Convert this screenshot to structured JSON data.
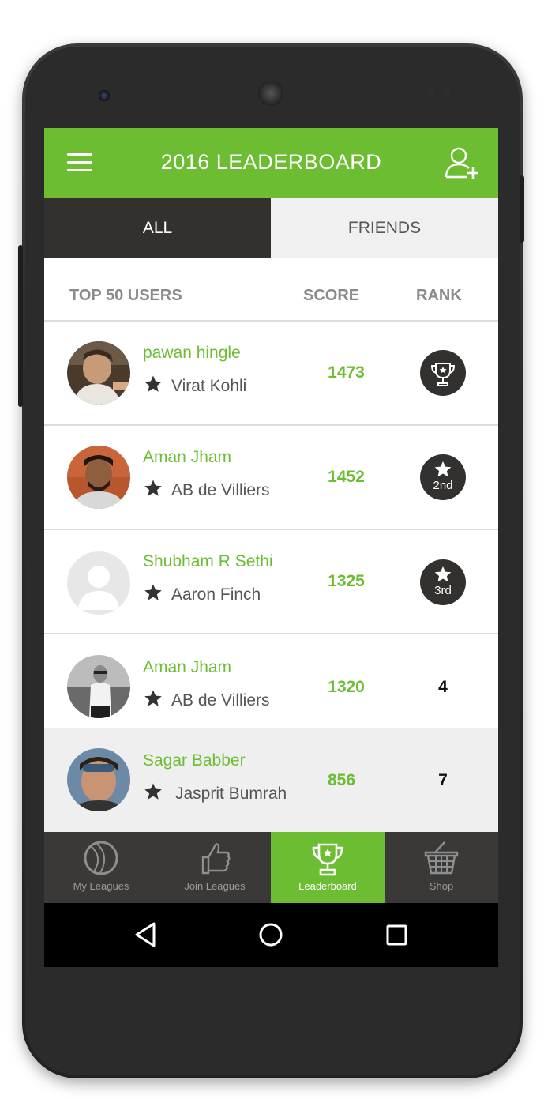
{
  "header": {
    "title": "2016 LEADERBOARD",
    "menu_icon": "hamburger-icon",
    "add_user_icon": "add-user-icon"
  },
  "tabs": [
    {
      "label": "ALL",
      "active": true
    },
    {
      "label": "FRIENDS",
      "active": false
    }
  ],
  "columns": {
    "users": "TOP 50 USERS",
    "score": "SCORE",
    "rank": "RANK"
  },
  "rows": [
    {
      "name": "pawan hingle",
      "player": "Virat Kohli",
      "score": "1473",
      "rank": "",
      "badge": "trophy"
    },
    {
      "name": "Aman Jham",
      "player": "AB de Villiers",
      "score": "1452",
      "rank": "2nd",
      "badge": "star"
    },
    {
      "name": "Shubham R Sethi",
      "player": "Aaron Finch",
      "score": "1325",
      "rank": "3rd",
      "badge": "star"
    },
    {
      "name": "Aman Jham",
      "player": "AB de Villiers",
      "score": "1320",
      "rank": "4",
      "badge": "none"
    },
    {
      "name": "Sagar Babber",
      "player": "Jasprit Bumrah",
      "score": "856",
      "rank": "7",
      "badge": "none"
    }
  ],
  "bottom_nav": [
    {
      "label": "My Leagues",
      "icon": "cricket-ball-icon",
      "active": false
    },
    {
      "label": "Join Leagues",
      "icon": "thumbs-up-icon",
      "active": false
    },
    {
      "label": "Leaderboard",
      "icon": "trophy-icon",
      "active": true
    },
    {
      "label": "Shop",
      "icon": "shopping-basket-icon",
      "active": false
    }
  ],
  "system_nav": [
    "back-icon",
    "home-icon",
    "recents-icon"
  ],
  "colors": {
    "brand_green": "#6cbd32",
    "dark": "#333130",
    "nav_bg": "#3b3937"
  }
}
